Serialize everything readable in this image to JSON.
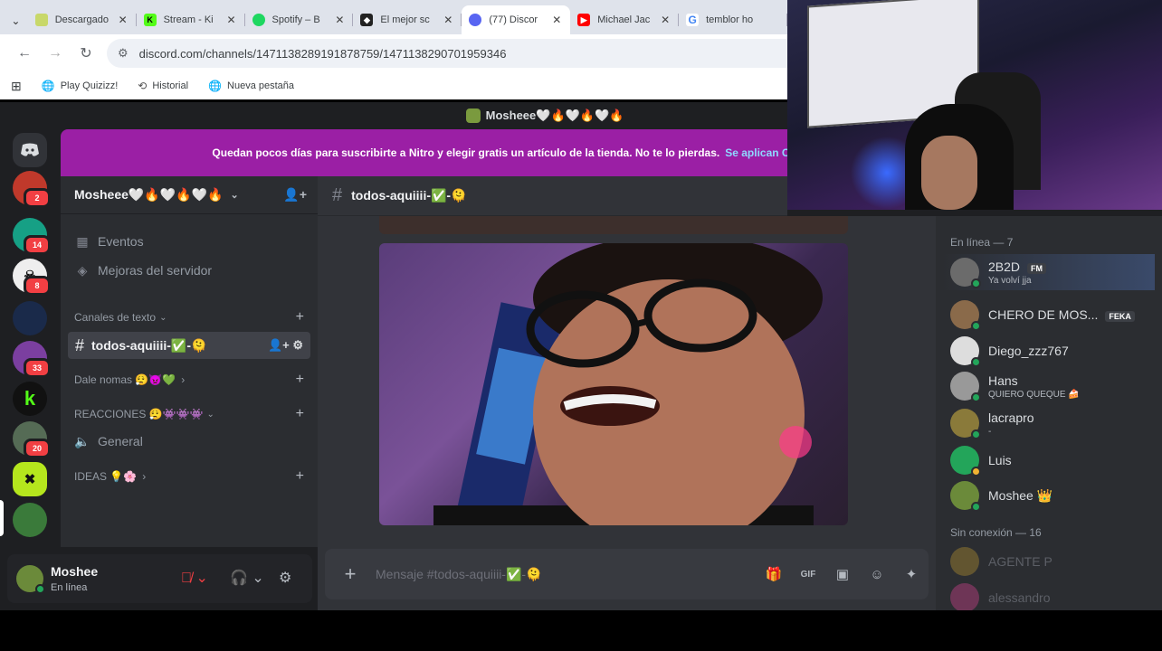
{
  "browser": {
    "tabs": [
      {
        "label": "Descargado",
        "fav_color": "#c8d86a",
        "active": false
      },
      {
        "label": "Stream - Ki",
        "fav_color": "#53fc18",
        "fav_glyph": "K",
        "active": false
      },
      {
        "label": "Spotify – B",
        "fav_color": "#1ed760",
        "active": false
      },
      {
        "label": "El mejor sc",
        "fav_color": "#222222",
        "active": false
      },
      {
        "label": "(77) Discor",
        "fav_color": "#5865f2",
        "active": true
      },
      {
        "label": "Michael Jac",
        "fav_color": "#ff0000",
        "active": false
      },
      {
        "label": "temblor ho",
        "fav_color": "#4285f4",
        "fav_glyph": "G",
        "active": false
      }
    ],
    "url": "discord.com/channels/1471138289191878759/1471138290701959346",
    "bookmarks": [
      {
        "label": "Play Quizizz!",
        "icon": "globe-icon"
      },
      {
        "label": "Historial",
        "icon": "history-icon"
      },
      {
        "label": "Nueva pestaña",
        "icon": "globe-icon"
      }
    ]
  },
  "discord": {
    "window_title": "Mosheee🤍🔥🤍🔥🤍🔥",
    "banner": {
      "text": "Quedan pocos días para suscribirte a Nitro y elegir gratis un artículo de la tienda. No te lo pierdas.",
      "link": "Se aplican C"
    },
    "servers": [
      {
        "color": "#c0392b",
        "badge": "2"
      },
      {
        "color": "#16a085",
        "badge": "14"
      },
      {
        "color": "#eeeeee",
        "badge": "8"
      },
      {
        "color": "#1a2a4a",
        "badge": ""
      },
      {
        "color": "#7b3fa0",
        "badge": "33"
      },
      {
        "color": "#111111",
        "badge": "",
        "glyph": "k"
      },
      {
        "color": "#556b55",
        "badge": "20"
      },
      {
        "color": "#b5e61d",
        "badge": ""
      },
      {
        "color": "#3a7a3a",
        "badge": ""
      }
    ],
    "server_name": "Mosheee🤍🔥🤍🔥🤍🔥",
    "sidebar": {
      "events": "Eventos",
      "boosts": "Mejoras del servidor",
      "cat_text": "Canales de texto",
      "active_channel": "todos-aquiiii-✅-🫠",
      "cat_dale": "Dale nomas 😮‍💨👿💚",
      "cat_reacciones": "REACCIONES 😮‍💨👾👾👾",
      "voice_general": "General",
      "cat_ideas": "IDEAS 💡🌸"
    },
    "user": {
      "name": "Moshee",
      "status": "En línea"
    },
    "channel_header": "todos-aquiiii-✅-🫠",
    "composer_placeholder": "Mensaje #todos-aquiiii-✅-🫠",
    "members": {
      "online_header": "En línea — 7",
      "offline_header": "Sin conexión — 16",
      "online": [
        {
          "name": "2B2D",
          "sub": "Ya volví jja",
          "tag": "FM",
          "color": "#6b6b6b"
        },
        {
          "name": "CHERO DE MOS...",
          "sub": "",
          "tag": "FEKA",
          "color": "#8a6a4a"
        },
        {
          "name": "Diego_zzz767",
          "sub": "",
          "tag": "",
          "color": "#dddddd"
        },
        {
          "name": "Hans",
          "sub": "QUIERO QUEQUE 🍰",
          "tag": "",
          "color": "#999999"
        },
        {
          "name": "lacrapro",
          "sub": "-",
          "tag": "",
          "color": "#8a7a3a"
        },
        {
          "name": "Luis",
          "sub": "",
          "tag": "",
          "color": "#23a55a"
        },
        {
          "name": "Moshee 👑",
          "sub": "",
          "tag": "",
          "color": "#6b8a3a"
        }
      ],
      "offline": [
        {
          "name": "AGENTE P",
          "color": "#c8a030"
        },
        {
          "name": "alessandro",
          "color": "#eb459e"
        }
      ]
    }
  }
}
